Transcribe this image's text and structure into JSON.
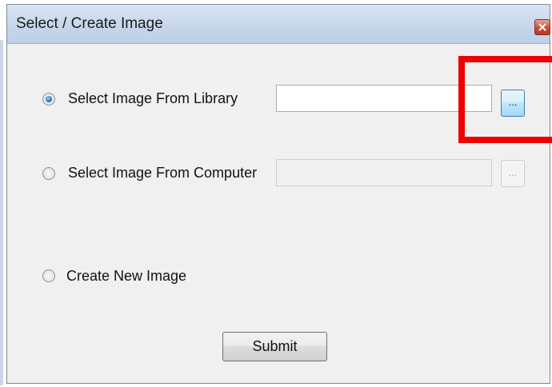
{
  "window": {
    "title": "Select / Create Image",
    "close_label": "x"
  },
  "options": {
    "library": {
      "label": "Select Image From Library",
      "checked": true,
      "value": ""
    },
    "computer": {
      "label": "Select Image From Computer",
      "checked": false,
      "value": "",
      "enabled": false
    },
    "create": {
      "label": "Create New Image",
      "checked": false
    }
  },
  "browse_label": "...",
  "submit_label": "Submit",
  "colors": {
    "highlight": "#ee0000",
    "radio_selected": "#2a7cc8"
  }
}
